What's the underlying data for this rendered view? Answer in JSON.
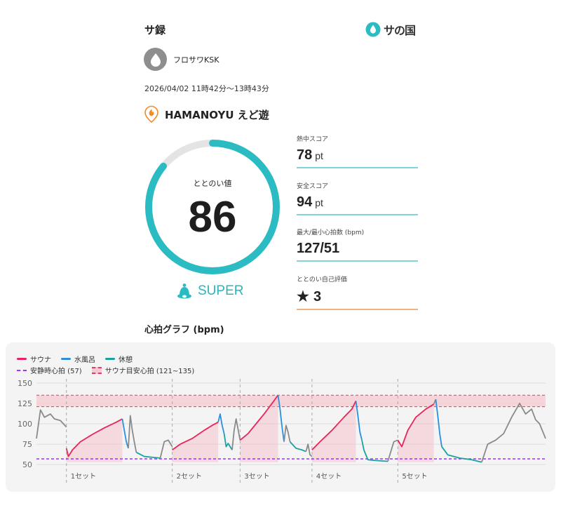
{
  "header": {
    "title": "サ録",
    "brand": "サの国"
  },
  "user": {
    "name": "フロサワKSK"
  },
  "session": {
    "datetime": "2026/04/02 11時42分〜13時43分"
  },
  "facility": {
    "name": "HAMANOYU えど遊"
  },
  "totonoi": {
    "label": "ととのい値",
    "value": "86",
    "score": 86,
    "rank": "SUPER"
  },
  "stats": [
    {
      "label": "熱中スコア",
      "value": "78",
      "unit": "pt"
    },
    {
      "label": "安全スコア",
      "value": "94",
      "unit": "pt"
    },
    {
      "label": "最大/最小心拍数 (bpm)",
      "value": "127/51",
      "unit": ""
    },
    {
      "label": "ととのい自己評価",
      "value": "3",
      "unit": ""
    }
  ],
  "graph": {
    "title": "心拍グラフ (bpm)"
  },
  "legend": {
    "sauna": "サウナ",
    "water": "水風呂",
    "rest": "休憩",
    "resting_hr": "安静時心拍 (57)",
    "target_hr": "サウナ目安心拍 (121~135)"
  },
  "colors": {
    "sauna": "#e8245a",
    "water": "#2a8fe0",
    "rest": "#1aa1a0",
    "other": "#8a8a8a",
    "resting": "#9b30ff",
    "target": "#e83a64",
    "ring": "#2bbcc3",
    "orange": "#f08a24"
  },
  "chart_data": {
    "type": "line",
    "ylabel": "",
    "yticks": [
      50,
      75,
      100,
      125,
      150
    ],
    "ylim": [
      45,
      155
    ],
    "resting_hr": 57,
    "target_range": [
      121,
      135
    ],
    "sets": [
      "1セット",
      "2セット",
      "3セット",
      "4セット",
      "5セット"
    ],
    "series": [
      {
        "name": "",
        "phase": "other",
        "points": [
          [
            0,
            82
          ],
          [
            2,
            117
          ],
          [
            4,
            108
          ],
          [
            7,
            112
          ],
          [
            9,
            106
          ],
          [
            12,
            104
          ],
          [
            15,
            96
          ]
        ]
      },
      {
        "name": "サウナ",
        "phase": "sauna",
        "points": [
          [
            15,
            70
          ],
          [
            16,
            60
          ],
          [
            18,
            68
          ],
          [
            22,
            78
          ],
          [
            28,
            87
          ],
          [
            34,
            95
          ],
          [
            40,
            102
          ],
          [
            43,
            106
          ]
        ]
      },
      {
        "name": "水風呂",
        "phase": "water",
        "points": [
          [
            43,
            106
          ],
          [
            44,
            92
          ],
          [
            45,
            78
          ],
          [
            46,
            70
          ]
        ]
      },
      {
        "name": "",
        "phase": "other",
        "points": [
          [
            46,
            70
          ],
          [
            47,
            110
          ],
          [
            48,
            92
          ],
          [
            49,
            78
          ],
          [
            50,
            65
          ]
        ]
      },
      {
        "name": "休憩",
        "phase": "rest",
        "points": [
          [
            50,
            65
          ],
          [
            54,
            60
          ],
          [
            58,
            59
          ],
          [
            62,
            58
          ]
        ]
      },
      {
        "name": "",
        "phase": "other",
        "points": [
          [
            62,
            58
          ],
          [
            64,
            78
          ],
          [
            66,
            80
          ],
          [
            68,
            72
          ]
        ]
      },
      {
        "name": "サウナ",
        "phase": "sauna",
        "points": [
          [
            68,
            68
          ],
          [
            72,
            75
          ],
          [
            78,
            82
          ],
          [
            84,
            92
          ],
          [
            88,
            98
          ],
          [
            91,
            102
          ]
        ]
      },
      {
        "name": "水風呂",
        "phase": "water",
        "points": [
          [
            91,
            102
          ],
          [
            92,
            112
          ],
          [
            93,
            98
          ],
          [
            94,
            88
          ]
        ]
      },
      {
        "name": "休憩",
        "phase": "rest",
        "points": [
          [
            94,
            88
          ],
          [
            95,
            72
          ],
          [
            96,
            76
          ],
          [
            98,
            68
          ]
        ]
      },
      {
        "name": "",
        "phase": "other",
        "points": [
          [
            98,
            68
          ],
          [
            99,
            92
          ],
          [
            100,
            106
          ],
          [
            102,
            80
          ]
        ]
      },
      {
        "name": "サウナ",
        "phase": "sauna",
        "points": [
          [
            102,
            80
          ],
          [
            106,
            88
          ],
          [
            110,
            100
          ],
          [
            114,
            112
          ],
          [
            118,
            125
          ],
          [
            121,
            135
          ]
        ]
      },
      {
        "name": "水風呂",
        "phase": "water",
        "points": [
          [
            121,
            135
          ],
          [
            122,
            118
          ],
          [
            123,
            96
          ],
          [
            124,
            78
          ]
        ]
      },
      {
        "name": "",
        "phase": "other",
        "points": [
          [
            124,
            78
          ],
          [
            125,
            98
          ],
          [
            126,
            90
          ],
          [
            127,
            78
          ]
        ]
      },
      {
        "name": "休憩",
        "phase": "rest",
        "points": [
          [
            127,
            78
          ],
          [
            130,
            70
          ],
          [
            133,
            68
          ],
          [
            135,
            66
          ]
        ]
      },
      {
        "name": "",
        "phase": "other",
        "points": [
          [
            135,
            66
          ],
          [
            136,
            75
          ],
          [
            137,
            62
          ],
          [
            138,
            60
          ]
        ]
      },
      {
        "name": "サウナ",
        "phase": "sauna",
        "points": [
          [
            138,
            68
          ],
          [
            142,
            78
          ],
          [
            148,
            92
          ],
          [
            154,
            108
          ],
          [
            158,
            118
          ],
          [
            160,
            128
          ]
        ]
      },
      {
        "name": "水風呂",
        "phase": "water",
        "points": [
          [
            160,
            128
          ],
          [
            161,
            110
          ],
          [
            162,
            90
          ],
          [
            163,
            80
          ]
        ]
      },
      {
        "name": "休憩",
        "phase": "rest",
        "points": [
          [
            163,
            80
          ],
          [
            164,
            68
          ],
          [
            166,
            56
          ],
          [
            170,
            55
          ],
          [
            176,
            54
          ]
        ]
      },
      {
        "name": "",
        "phase": "other",
        "points": [
          [
            176,
            54
          ],
          [
            178,
            70
          ],
          [
            179,
            78
          ],
          [
            181,
            80
          ]
        ]
      },
      {
        "name": "サウナ",
        "phase": "sauna",
        "points": [
          [
            181,
            80
          ],
          [
            183,
            72
          ],
          [
            186,
            92
          ],
          [
            190,
            108
          ],
          [
            195,
            118
          ],
          [
            199,
            124
          ]
        ]
      },
      {
        "name": "",
        "phase": "other",
        "points": [
          [
            199,
            124
          ],
          [
            200,
            130
          ]
        ]
      },
      {
        "name": "水風呂",
        "phase": "water",
        "points": [
          [
            200,
            130
          ],
          [
            201,
            110
          ],
          [
            202,
            88
          ],
          [
            203,
            72
          ]
        ]
      },
      {
        "name": "休憩",
        "phase": "rest",
        "points": [
          [
            203,
            72
          ],
          [
            206,
            62
          ],
          [
            212,
            58
          ],
          [
            218,
            56
          ],
          [
            223,
            53
          ]
        ]
      },
      {
        "name": "",
        "phase": "other",
        "points": [
          [
            223,
            53
          ],
          [
            226,
            75
          ],
          [
            230,
            80
          ],
          [
            234,
            88
          ],
          [
            238,
            108
          ],
          [
            242,
            125
          ],
          [
            245,
            112
          ],
          [
            248,
            118
          ],
          [
            250,
            105
          ],
          [
            252,
            100
          ],
          [
            255,
            82
          ]
        ]
      }
    ],
    "set_starts": [
      15,
      68,
      102,
      138,
      181
    ]
  }
}
